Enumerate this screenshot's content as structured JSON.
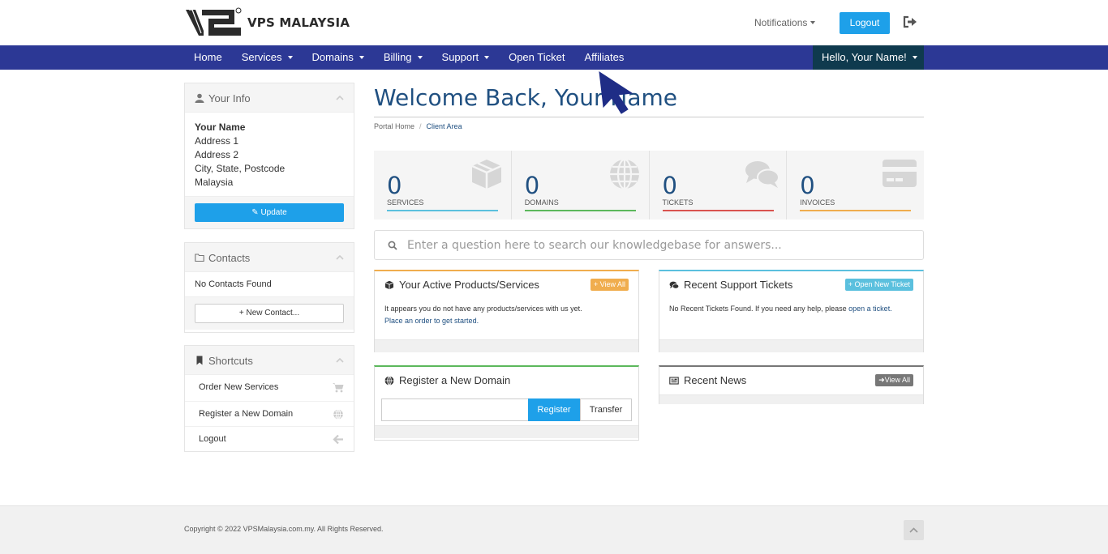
{
  "brand": {
    "name": "VPS MALAYSIA",
    "primary": "#2c3895",
    "accent": "#1ea0e9",
    "heading": "#205081"
  },
  "header": {
    "notifications": "Notifications",
    "logout": "Logout",
    "logout_icon": "sign-out-icon"
  },
  "nav": {
    "items": [
      {
        "label": "Home",
        "dropdown": false
      },
      {
        "label": "Services",
        "dropdown": true
      },
      {
        "label": "Domains",
        "dropdown": true
      },
      {
        "label": "Billing",
        "dropdown": true
      },
      {
        "label": "Support",
        "dropdown": true
      },
      {
        "label": "Open Ticket",
        "dropdown": false
      },
      {
        "label": "Affiliates",
        "dropdown": false
      }
    ],
    "user": "Hello, Your Name!"
  },
  "sidebar": {
    "info": {
      "title": "Your Info",
      "name": "Your Name",
      "lines": [
        "Address 1",
        "Address 2",
        "City, State, Postcode",
        "Malaysia"
      ],
      "update": "Update"
    },
    "contacts": {
      "title": "Contacts",
      "empty": "No Contacts Found",
      "new": "New Contact..."
    },
    "shortcuts": {
      "title": "Shortcuts",
      "items": [
        {
          "label": "Order New Services",
          "icon": "cart-icon"
        },
        {
          "label": "Register a New Domain",
          "icon": "globe-icon"
        },
        {
          "label": "Logout",
          "icon": "arrow-left-icon"
        }
      ]
    }
  },
  "main": {
    "welcome": "Welcome Back, Your Name",
    "breadcrumb": {
      "home": "Portal Home",
      "sep": "/",
      "current": "Client Area"
    },
    "stats": [
      {
        "value": "0",
        "label": "SERVICES",
        "color": "#5bc0de",
        "icon": "cube-icon"
      },
      {
        "value": "0",
        "label": "DOMAINS",
        "color": "#5cb85c",
        "icon": "globe-icon"
      },
      {
        "value": "0",
        "label": "TICKETS",
        "color": "#d9534f",
        "icon": "comments-icon"
      },
      {
        "value": "0",
        "label": "INVOICES",
        "color": "#f0ad4e",
        "icon": "credit-card-icon"
      }
    ],
    "kb_placeholder": "Enter a question here to search our knowledgebase for answers...",
    "products": {
      "title": "Your Active Products/Services",
      "badge": "View All",
      "text": "It appears you do not have any products/services with us yet.",
      "link": "Place an order to get started."
    },
    "tickets": {
      "title": "Recent Support Tickets",
      "badge": "Open New Ticket",
      "text": "No Recent Tickets Found. If you need any help, please",
      "link": "open a ticket."
    },
    "domain": {
      "title": "Register a New Domain",
      "register": "Register",
      "transfer": "Transfer"
    },
    "news": {
      "title": "Recent News",
      "badge": "View All"
    }
  },
  "footer": {
    "copyright": "Copyright © 2022 VPSMalaysia.com.my. All Rights Reserved."
  }
}
